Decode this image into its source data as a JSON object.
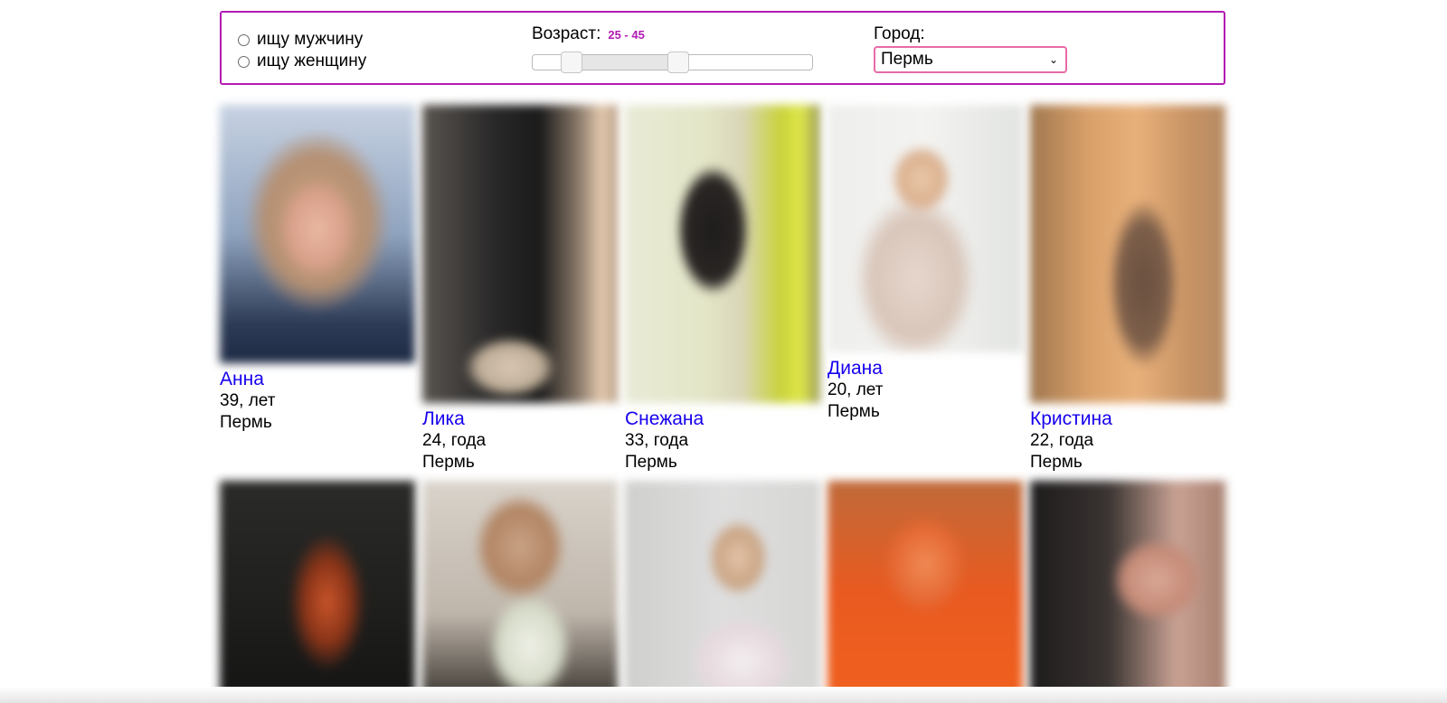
{
  "filters": {
    "gender_options": [
      "ищу мужчину",
      "ищу женщину"
    ],
    "age_label": "Возраст:",
    "age_value": "25 - 45",
    "age_min": 25,
    "age_max": 45,
    "city_label": "Город:",
    "city_selected": "Пермь"
  },
  "profiles": [
    {
      "name": "Анна",
      "age_text": "39, лет",
      "city": "Пермь"
    },
    {
      "name": "Лика",
      "age_text": "24, года",
      "city": "Пермь"
    },
    {
      "name": "Снежана",
      "age_text": "33, года",
      "city": "Пермь"
    },
    {
      "name": "Диана",
      "age_text": "20, лет",
      "city": "Пермь"
    },
    {
      "name": "Кристина",
      "age_text": "22, года",
      "city": "Пермь"
    }
  ],
  "colors": {
    "accent": "#b21bb2",
    "name_link": "#1600ee",
    "select_border": "#e86aa6"
  }
}
